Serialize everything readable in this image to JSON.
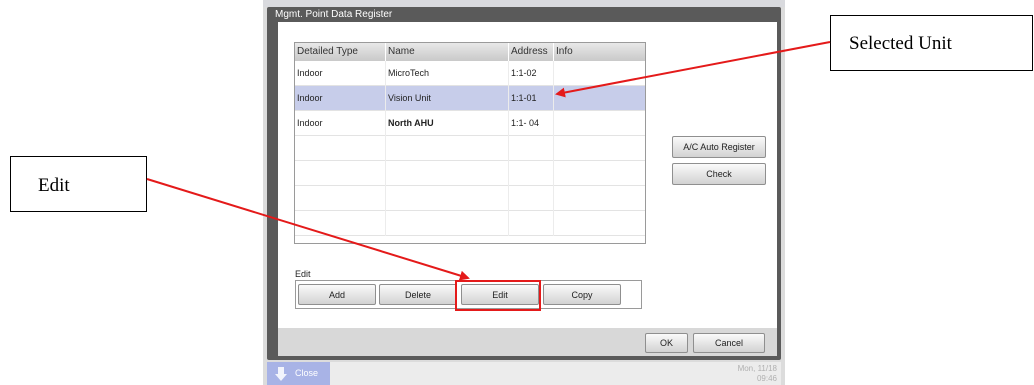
{
  "window": {
    "title": "Mgmt. Point Data Register"
  },
  "table": {
    "columns": [
      "Detailed Type",
      "Name",
      "Address",
      "Info"
    ],
    "rows": [
      {
        "type": "Indoor",
        "name": "MicroTech",
        "address": "1:1-02",
        "info": ""
      },
      {
        "type": "Indoor",
        "name": "Vision Unit",
        "address": "1:1-01",
        "info": ""
      },
      {
        "type": "Indoor",
        "name": "North AHU",
        "address": "1:1- 04",
        "info": ""
      }
    ],
    "selected_row": 2
  },
  "side_buttons": {
    "auto_register": "A/C Auto Register",
    "check": "Check"
  },
  "edit_group": {
    "label": "Edit",
    "add": "Add",
    "delete": "Delete",
    "edit": "Edit",
    "copy": "Copy"
  },
  "footer": {
    "ok": "OK",
    "cancel": "Cancel"
  },
  "taskbar": {
    "close": "Close",
    "date": "Mon, 11/18",
    "time": "09:46"
  },
  "annotations": {
    "selected_unit": "Selected Unit",
    "edit": "Edit",
    "arrow_color": "#e41a1a"
  }
}
